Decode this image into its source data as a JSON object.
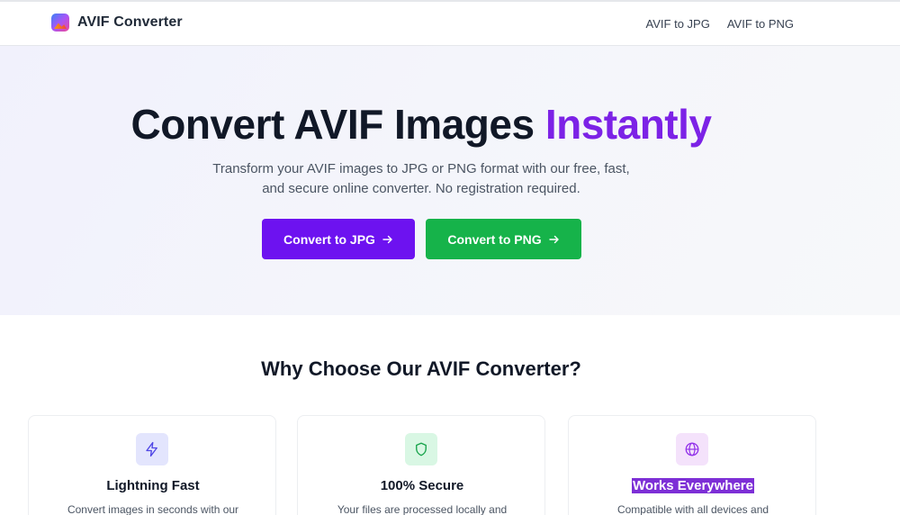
{
  "header": {
    "brand": "AVIF Converter",
    "nav": [
      "AVIF to JPG",
      "AVIF to PNG"
    ]
  },
  "hero": {
    "title_main": "Convert AVIF Images",
    "title_accent": "Instantly",
    "subtitle_line1": "Transform your AVIF images to JPG or PNG format with our free, fast,",
    "subtitle_line2": "and secure online converter. No registration required.",
    "buttons": [
      {
        "label": "Convert to JPG",
        "color": "#6d12f0"
      },
      {
        "label": "Convert to PNG",
        "color": "#16b34a"
      }
    ]
  },
  "features": {
    "title": "Why Choose Our AVIF Converter?",
    "cards": [
      {
        "icon": "lightning-icon",
        "title": "Lightning Fast",
        "desc": "Convert images in seconds with our"
      },
      {
        "icon": "shield-icon",
        "title": "100% Secure",
        "desc": "Your files are processed locally and"
      },
      {
        "icon": "globe-icon",
        "title": "Works Everywhere",
        "desc": "Compatible with all devices and"
      }
    ]
  },
  "colors": {
    "accent_purple": "#7c22e6",
    "button_purple": "#6d12f0",
    "button_green": "#16b34a"
  }
}
